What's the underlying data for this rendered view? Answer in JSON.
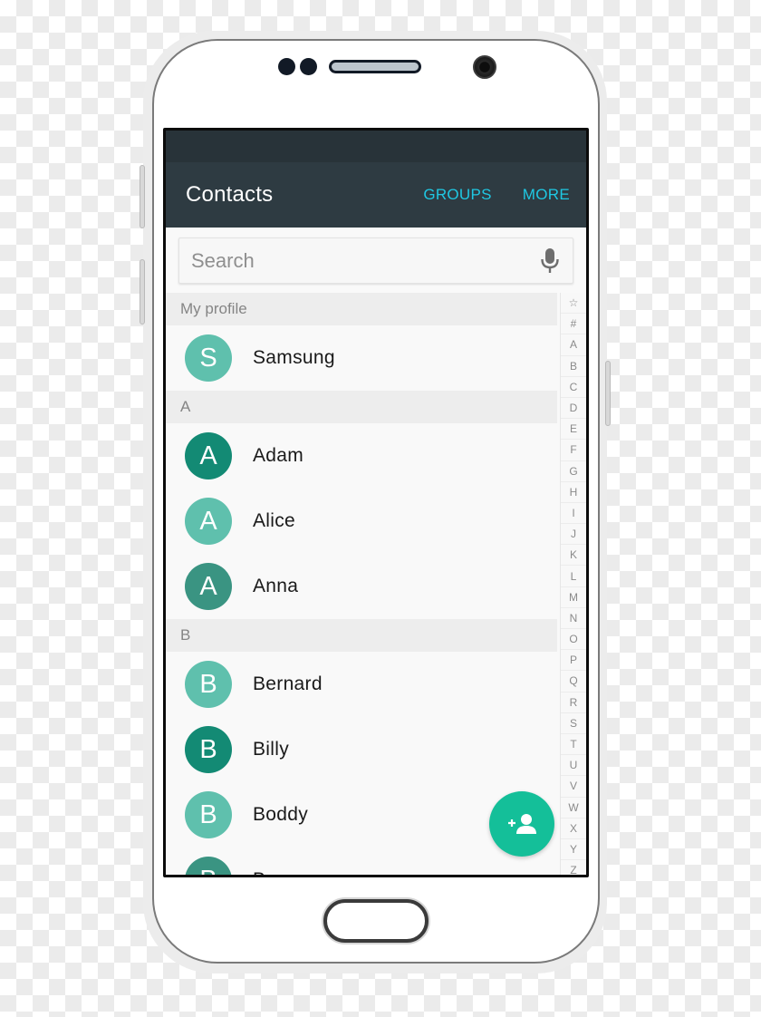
{
  "app_bar": {
    "title": "Contacts",
    "actions": [
      {
        "label": "GROUPS"
      },
      {
        "label": "MORE"
      }
    ]
  },
  "search": {
    "placeholder": "Search",
    "value": "",
    "icon": "microphone-icon"
  },
  "sections": {
    "profile": {
      "header": "My profile",
      "contact": {
        "name": "Samsung",
        "initial": "S",
        "color": "#5fc0ad"
      }
    },
    "a": {
      "header": "A",
      "contacts": [
        {
          "name": "Adam",
          "initial": "A",
          "color": "#138a74"
        },
        {
          "name": "Alice",
          "initial": "A",
          "color": "#5fc0ad"
        },
        {
          "name": "Anna",
          "initial": "A",
          "color": "#3a9482"
        }
      ]
    },
    "b": {
      "header": "B",
      "contacts": [
        {
          "name": "Bernard",
          "initial": "B",
          "color": "#5fc0ad"
        },
        {
          "name": "Billy",
          "initial": "B",
          "color": "#138a74"
        },
        {
          "name": "Boddy",
          "initial": "B",
          "color": "#5fc0ad"
        },
        {
          "name": "B",
          "initial": "B",
          "color": "#3a9482"
        }
      ]
    }
  },
  "index_rail": [
    "☆",
    "#",
    "A",
    "B",
    "C",
    "D",
    "E",
    "F",
    "G",
    "H",
    "I",
    "J",
    "K",
    "L",
    "M",
    "N",
    "O",
    "P",
    "Q",
    "R",
    "S",
    "T",
    "U",
    "V",
    "W",
    "X",
    "Y",
    "Z"
  ],
  "fab": {
    "icon": "add-contact-icon",
    "color": "#14bf99"
  },
  "colors": {
    "status_bar": "#283339",
    "app_bar": "#2e3b42",
    "accent": "#1fc8e3"
  }
}
